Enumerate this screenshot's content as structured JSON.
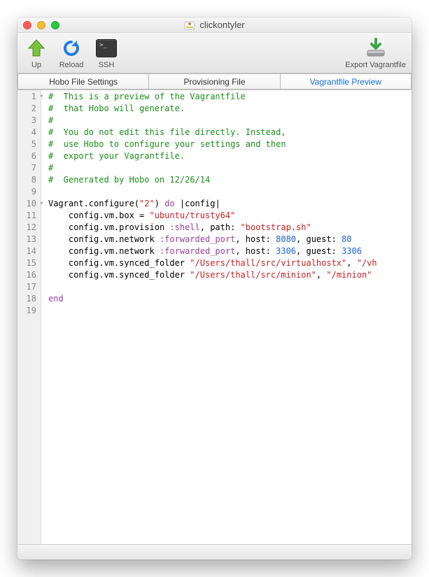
{
  "window": {
    "title": "clickontyler"
  },
  "toolbar": {
    "up": "Up",
    "reload": "Reload",
    "ssh": "SSH",
    "export": "Export Vagrantfile"
  },
  "tabs": [
    {
      "label": "Hobo File Settings",
      "active": false
    },
    {
      "label": "Provisioning File",
      "active": false
    },
    {
      "label": "Vagrantfile Preview",
      "active": true
    }
  ],
  "code": {
    "lines": [
      {
        "n": 1,
        "fold": true,
        "segs": [
          {
            "t": "#  This is a preview of the Vagrantfile",
            "c": "c-comment"
          }
        ]
      },
      {
        "n": 2,
        "segs": [
          {
            "t": "#  that Hobo will generate.",
            "c": "c-comment"
          }
        ]
      },
      {
        "n": 3,
        "segs": [
          {
            "t": "#",
            "c": "c-comment"
          }
        ]
      },
      {
        "n": 4,
        "segs": [
          {
            "t": "#  You do not edit this file directly. Instead,",
            "c": "c-comment"
          }
        ]
      },
      {
        "n": 5,
        "segs": [
          {
            "t": "#  use Hobo to configure your settings and then",
            "c": "c-comment"
          }
        ]
      },
      {
        "n": 6,
        "segs": [
          {
            "t": "#  export your Vagrantfile.",
            "c": "c-comment"
          }
        ]
      },
      {
        "n": 7,
        "segs": [
          {
            "t": "#",
            "c": "c-comment"
          }
        ]
      },
      {
        "n": 8,
        "segs": [
          {
            "t": "#  Generated by Hobo on 12/26/14",
            "c": "c-comment"
          }
        ]
      },
      {
        "n": 9,
        "segs": [
          {
            "t": "",
            "c": ""
          }
        ]
      },
      {
        "n": 10,
        "fold": true,
        "segs": [
          {
            "t": "Vagrant.configure(",
            "c": "c-key"
          },
          {
            "t": "\"2\"",
            "c": "c-str"
          },
          {
            "t": ") ",
            "c": "c-key"
          },
          {
            "t": "do",
            "c": "c-sym"
          },
          {
            "t": " |config|",
            "c": "c-key"
          }
        ]
      },
      {
        "n": 11,
        "segs": [
          {
            "t": "    config.vm.box = ",
            "c": "c-key"
          },
          {
            "t": "\"ubuntu/trusty64\"",
            "c": "c-str"
          }
        ]
      },
      {
        "n": 12,
        "segs": [
          {
            "t": "    config.vm.provision ",
            "c": "c-key"
          },
          {
            "t": ":shell",
            "c": "c-sym"
          },
          {
            "t": ", path: ",
            "c": "c-key"
          },
          {
            "t": "\"bootstrap.sh\"",
            "c": "c-str"
          }
        ]
      },
      {
        "n": 13,
        "segs": [
          {
            "t": "    config.vm.network ",
            "c": "c-key"
          },
          {
            "t": ":forwarded_port",
            "c": "c-sym"
          },
          {
            "t": ", host: ",
            "c": "c-key"
          },
          {
            "t": "8080",
            "c": "c-num"
          },
          {
            "t": ", guest: ",
            "c": "c-key"
          },
          {
            "t": "80",
            "c": "c-num"
          }
        ]
      },
      {
        "n": 14,
        "segs": [
          {
            "t": "    config.vm.network ",
            "c": "c-key"
          },
          {
            "t": ":forwarded_port",
            "c": "c-sym"
          },
          {
            "t": ", host: ",
            "c": "c-key"
          },
          {
            "t": "3306",
            "c": "c-num"
          },
          {
            "t": ", guest: ",
            "c": "c-key"
          },
          {
            "t": "3306",
            "c": "c-num"
          }
        ]
      },
      {
        "n": 15,
        "segs": [
          {
            "t": "    config.vm.synced_folder ",
            "c": "c-key"
          },
          {
            "t": "\"/Users/thall/src/virtualhostx\"",
            "c": "c-str"
          },
          {
            "t": ", ",
            "c": "c-key"
          },
          {
            "t": "\"/vh",
            "c": "c-str"
          }
        ]
      },
      {
        "n": 16,
        "segs": [
          {
            "t": "    config.vm.synced_folder ",
            "c": "c-key"
          },
          {
            "t": "\"/Users/thall/src/minion\"",
            "c": "c-str"
          },
          {
            "t": ", ",
            "c": "c-key"
          },
          {
            "t": "\"/minion\"",
            "c": "c-str"
          }
        ]
      },
      {
        "n": 17,
        "segs": [
          {
            "t": "",
            "c": ""
          }
        ]
      },
      {
        "n": 18,
        "segs": [
          {
            "t": "end",
            "c": "c-end"
          }
        ]
      },
      {
        "n": 19,
        "segs": [
          {
            "t": "",
            "c": ""
          }
        ]
      }
    ]
  }
}
